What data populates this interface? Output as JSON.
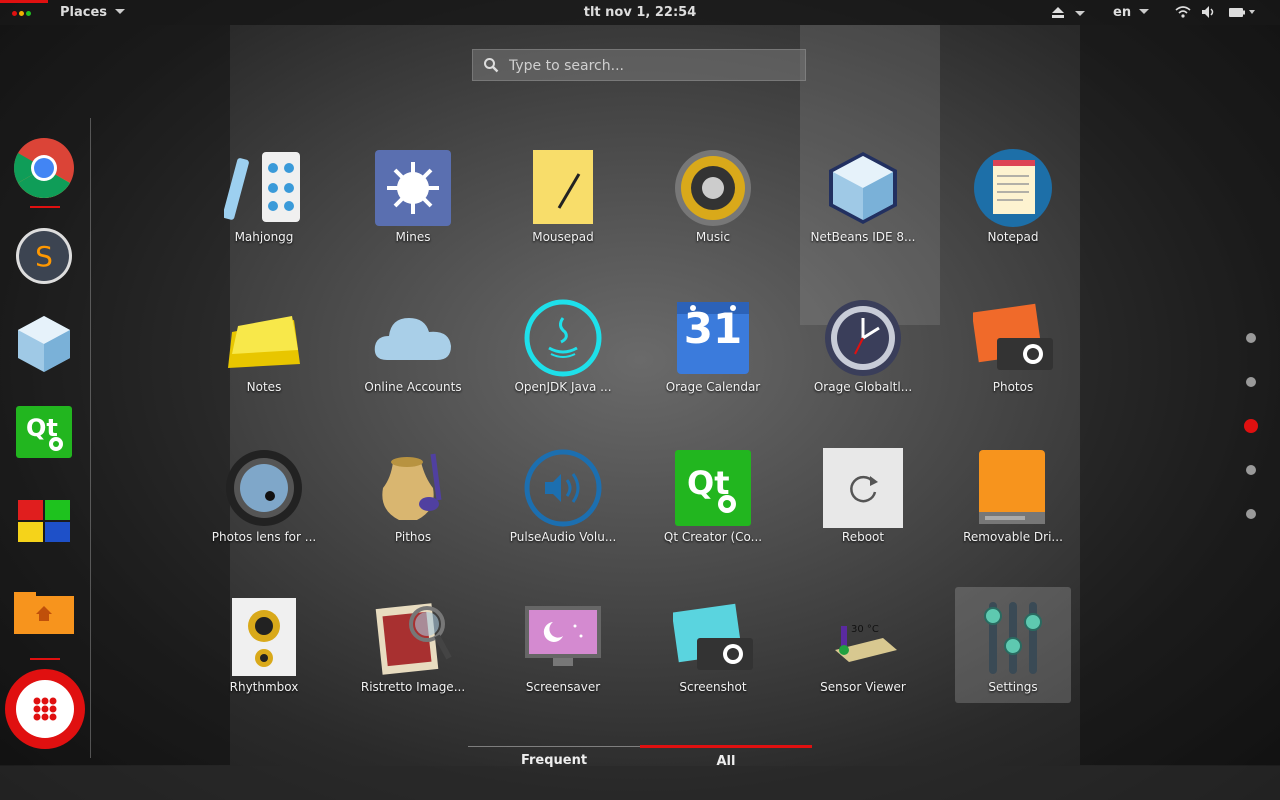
{
  "topbar": {
    "places_label": "Places",
    "clock": "tlt nov  1, 22:54",
    "lang": "en"
  },
  "search": {
    "placeholder": "Type to search..."
  },
  "dock": {
    "items": [
      "google-chrome",
      "sublime-text",
      "netbeans",
      "qt-creator",
      "windows-apps",
      "home-folder"
    ]
  },
  "apps": [
    {
      "label": "Mahjongg",
      "icon": "mahjongg-icon"
    },
    {
      "label": "Mines",
      "icon": "mines-icon"
    },
    {
      "label": "Mousepad",
      "icon": "mousepad-icon"
    },
    {
      "label": "Music",
      "icon": "music-icon"
    },
    {
      "label": "NetBeans IDE 8...",
      "icon": "netbeans-icon"
    },
    {
      "label": "Notepad",
      "icon": "notepad-icon"
    },
    {
      "label": "Notes",
      "icon": "notes-icon"
    },
    {
      "label": "Online Accounts",
      "icon": "online-accounts-icon"
    },
    {
      "label": "OpenJDK Java ...",
      "icon": "java-icon"
    },
    {
      "label": "Orage Calendar",
      "icon": "calendar-icon",
      "calendar_day": "31"
    },
    {
      "label": "Orage Globaltl...",
      "icon": "clock-icon"
    },
    {
      "label": "Photos",
      "icon": "photos-icon"
    },
    {
      "label": "Photos lens for ...",
      "icon": "photos-lens-icon"
    },
    {
      "label": "Pithos",
      "icon": "pithos-icon"
    },
    {
      "label": "PulseAudio Volu...",
      "icon": "pulseaudio-icon"
    },
    {
      "label": "Qt Creator (Co...",
      "icon": "qt-creator-icon"
    },
    {
      "label": "Reboot",
      "icon": "reboot-icon"
    },
    {
      "label": "Removable Dri...",
      "icon": "removable-drive-icon"
    },
    {
      "label": "Rhythmbox",
      "icon": "rhythmbox-icon"
    },
    {
      "label": "Ristretto Image...",
      "icon": "ristretto-icon"
    },
    {
      "label": "Screensaver",
      "icon": "screensaver-icon"
    },
    {
      "label": "Screenshot",
      "icon": "screenshot-icon"
    },
    {
      "label": "Sensor Viewer",
      "icon": "sensor-viewer-icon",
      "sensor_reading": "30 °C"
    },
    {
      "label": "Settings",
      "icon": "settings-icon"
    }
  ],
  "tabs": {
    "frequent": "Frequent",
    "all": "All",
    "active": "All"
  },
  "pagination": {
    "pages": 5,
    "active_page": 3
  },
  "colors": {
    "accent": "#e01010"
  }
}
